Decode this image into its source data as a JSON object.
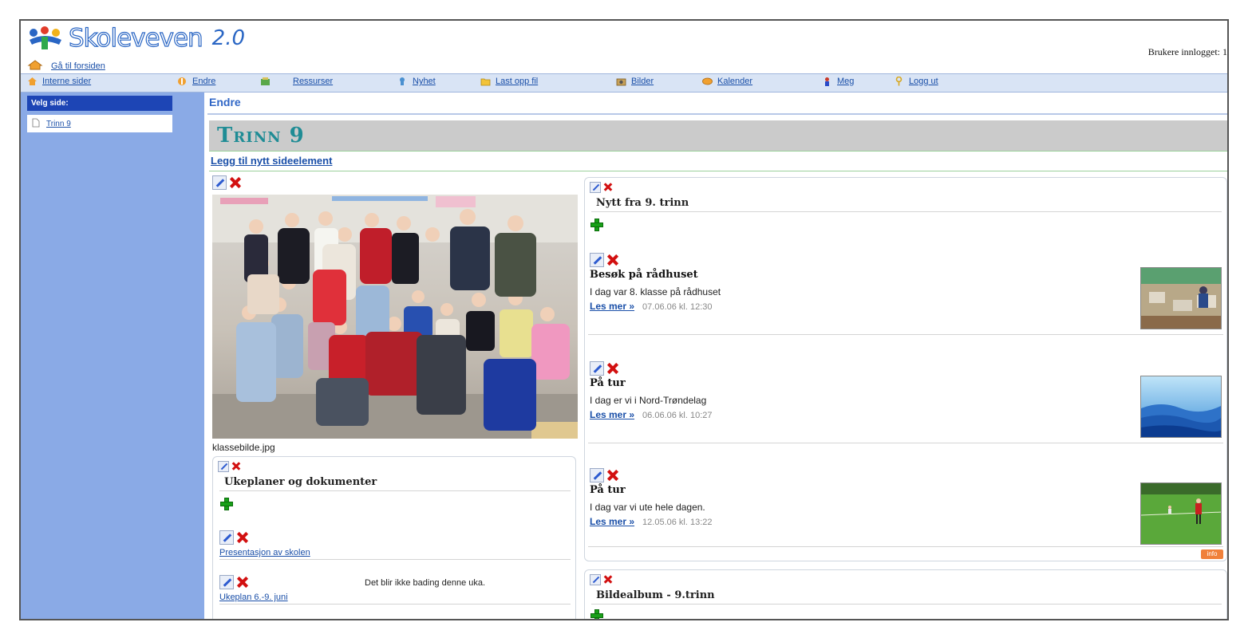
{
  "header": {
    "logo_text": "Skoleveven",
    "logo_version": "2.0",
    "home_link": "Gå til forsiden",
    "user_info": "Brukere innlogget: 1"
  },
  "nav": {
    "items": [
      {
        "label": "Interne sider",
        "icon": "home-icon"
      },
      {
        "label": "Endre",
        "icon": "edit-icon"
      },
      {
        "label": "Ressurser",
        "icon": "resources-icon"
      },
      {
        "label": "Nyhet",
        "icon": "news-icon"
      },
      {
        "label": "Last opp fil",
        "icon": "folder-icon"
      },
      {
        "label": "Bilder",
        "icon": "camera-icon"
      },
      {
        "label": "Kalender",
        "icon": "calendar-icon"
      },
      {
        "label": "Meg",
        "icon": "user-icon"
      },
      {
        "label": "Logg ut",
        "icon": "key-icon"
      }
    ]
  },
  "sidebar": {
    "heading": "Velg side:",
    "items": [
      {
        "label": "Trinn 9",
        "icon": "page-icon"
      }
    ]
  },
  "main": {
    "breadcrumb": "Endre",
    "page_title": "Trinn 9",
    "add_element_link": "Legg til nytt sideelement",
    "photo_caption": "klassebilde.jpg",
    "documents": {
      "title": "Ukeplaner og dokumenter",
      "items": [
        {
          "link": "Presentasjon av skolen",
          "note": ""
        },
        {
          "link": "Ukeplan 6.-9. juni",
          "note": "Det blir ikke bading denne uka."
        }
      ]
    },
    "news": {
      "title": "Nytt fra 9. trinn",
      "read_more": "Les mer »",
      "info_badge": "info",
      "items": [
        {
          "title": "Besøk på rådhuset",
          "text": "I dag var 8. klasse på rådhuset",
          "meta": "07.06.06 kl. 12:30"
        },
        {
          "title": "På tur",
          "text": "I dag er vi i Nord-Trøndelag",
          "meta": "06.06.06 kl. 10:27"
        },
        {
          "title": "På tur",
          "text": "I dag var vi ute hele dagen.",
          "meta": "12.05.06 kl. 13:22"
        }
      ]
    },
    "album": {
      "title": "Bildealbum - 9.trinn"
    }
  },
  "colors": {
    "sidebar_bg": "#8aaae6",
    "sidebar_heading_bg": "#1d45b5",
    "nav_bg": "#d9e4f5",
    "title_bar_bg": "#cbcbcb",
    "title_color": "#1f8c95",
    "link_color": "#1a4fa8",
    "delete_red": "#d21010",
    "add_green": "#19a019"
  }
}
